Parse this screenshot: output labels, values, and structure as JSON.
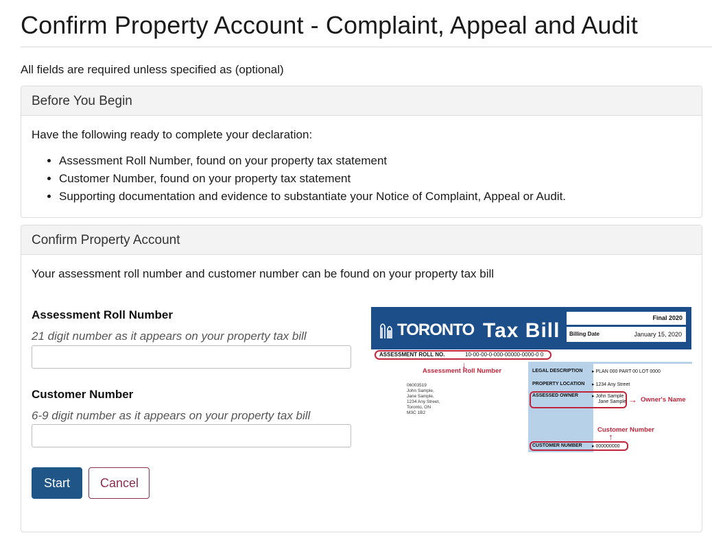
{
  "page": {
    "title": "Confirm Property Account - Complaint, Appeal and Audit",
    "required_note": "All fields are required unless specified as (optional)"
  },
  "before_you_begin": {
    "heading": "Before You Begin",
    "intro": "Have the following ready to complete your declaration:",
    "items": [
      "Assessment Roll Number, found on your property tax statement",
      "Customer Number, found on your property tax statement",
      "Supporting documentation and evidence to substantiate your Notice of Complaint, Appeal or Audit."
    ]
  },
  "confirm_account": {
    "heading": "Confirm Property Account",
    "intro": "Your assessment roll number and customer number can be found on your property tax bill",
    "roll_number": {
      "label": "Assessment Roll Number",
      "help": "21 digit number as it appears on your property tax bill",
      "value": ""
    },
    "customer_number": {
      "label": "Customer Number",
      "help": "6-9 digit number as it appears on your property tax bill",
      "value": ""
    },
    "buttons": {
      "start": "Start",
      "cancel": "Cancel"
    }
  },
  "tax_bill_image": {
    "logo_text": "TORONTO",
    "title": "Tax Bill",
    "final": "Final 2020",
    "billing_date_label": "Billing Date",
    "billing_date_value": "January 15, 2020",
    "roll_label": "ASSESSMENT ROLL NO.",
    "roll_value": "10-00-00-0-000-00000-0000-0 0",
    "roll_callout": "Assessment Roll Number",
    "address_lines": [
      "06003519",
      "John Sample,",
      "Jane Sample,",
      "1234 Any Street,",
      "Toronto, ON",
      "M3C 1B2"
    ],
    "legal_label": "LEGAL DESCRIPTION",
    "legal_value": "PLAN 000 PART 00 LOT 0000",
    "location_label": "PROPERTY LOCATION",
    "location_value": "1234 Any Street",
    "owner_label": "ASSESSED OWNER",
    "owner_value_1": "John Sample",
    "owner_value_2": "Jane Sample",
    "owner_callout": "Owner's Name",
    "customer_callout": "Customer Number",
    "customer_label": "CUSTOMER NUMBER",
    "customer_value": "000000000",
    "colors": {
      "banner": "#1c4f8a",
      "highlight": "#b7d1e9",
      "callout": "#c0243a"
    }
  }
}
